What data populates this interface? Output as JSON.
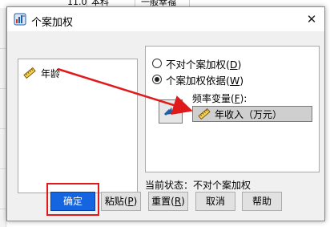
{
  "background": {
    "row_cells": [
      "11.0",
      "本科",
      "一般幸福"
    ]
  },
  "dialog": {
    "title": "个案加权",
    "close_glyph": "✕",
    "source_list": {
      "items": [
        {
          "label": "年龄",
          "icon": "ruler-icon"
        }
      ]
    },
    "weighting": {
      "option_none_prefix": "不对个案加权(",
      "option_none_key": "D",
      "option_none_suffix": ")",
      "option_by_prefix": "个案加权依据(",
      "option_by_key": "W",
      "option_by_suffix": ")",
      "selected": "by",
      "freq_var_prefix": "频率变量(",
      "freq_var_key": "F",
      "freq_var_suffix": "):",
      "freq_var_value": "年收入（万元）",
      "move_icon": "arrow-right-icon"
    },
    "status_text": "当前状态：不对个案加权",
    "buttons": {
      "ok": "确定",
      "paste_prefix": "粘贴(",
      "paste_key": "P",
      "paste_suffix": ")",
      "reset_prefix": "重置(",
      "reset_key": "R",
      "reset_suffix": ")",
      "cancel": "取消",
      "help": "帮助"
    },
    "annotation_colors": {
      "highlight_box": "#e0191b",
      "arrow": "#e0191b",
      "primary_button": "#1565e0"
    }
  }
}
